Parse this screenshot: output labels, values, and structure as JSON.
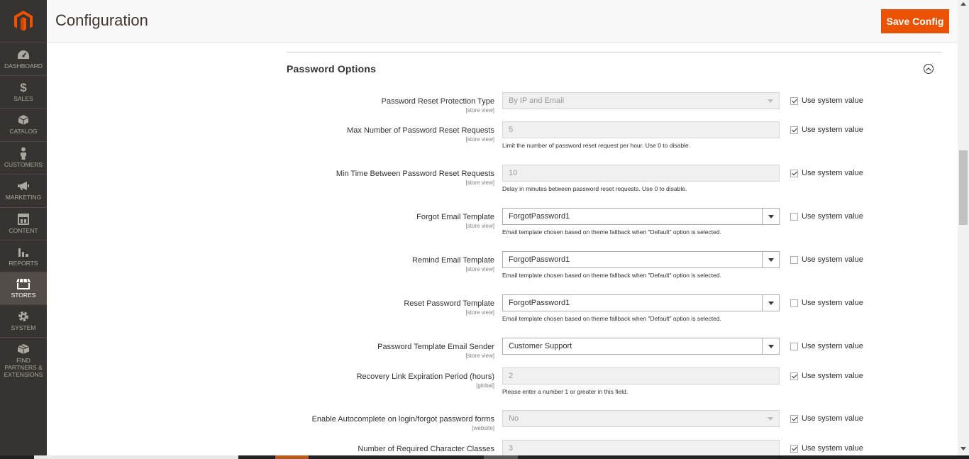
{
  "sidebar": {
    "items": [
      {
        "id": "dashboard",
        "label": "DASHBOARD",
        "icon": "dashboard-icon"
      },
      {
        "id": "sales",
        "label": "SALES",
        "icon": "dollar-icon"
      },
      {
        "id": "catalog",
        "label": "CATALOG",
        "icon": "box-icon"
      },
      {
        "id": "customers",
        "label": "CUSTOMERS",
        "icon": "person-icon"
      },
      {
        "id": "marketing",
        "label": "MARKETING",
        "icon": "megaphone-icon"
      },
      {
        "id": "content",
        "label": "CONTENT",
        "icon": "layout-icon"
      },
      {
        "id": "reports",
        "label": "REPORTS",
        "icon": "bar-chart-icon"
      },
      {
        "id": "stores",
        "label": "STORES",
        "icon": "storefront-icon",
        "active": true
      },
      {
        "id": "system",
        "label": "SYSTEM",
        "icon": "gear-icon"
      },
      {
        "id": "partners",
        "label": "FIND PARTNERS & EXTENSIONS",
        "icon": "cube-icon"
      }
    ]
  },
  "header": {
    "title": "Configuration",
    "save_label": "Save Config"
  },
  "section": {
    "title": "Password Options"
  },
  "fields": [
    {
      "label": "Password Reset Protection Type",
      "scope": "[store view]",
      "type": "select",
      "value": "By IP and Email",
      "disabled": true,
      "note": "",
      "use_system": true
    },
    {
      "label": "Max Number of Password Reset Requests",
      "scope": "[store view]",
      "type": "text",
      "value": "5",
      "disabled": true,
      "note": "Limit the number of password reset request per hour. Use 0 to disable.",
      "use_system": true
    },
    {
      "label": "Min Time Between Password Reset Requests",
      "scope": "[store view]",
      "type": "text",
      "value": "10",
      "disabled": true,
      "note": "Delay in minutes between password reset requests. Use 0 to disable.",
      "use_system": true
    },
    {
      "label": "Forgot Email Template",
      "scope": "[store view]",
      "type": "select",
      "value": "ForgotPassword1",
      "disabled": false,
      "note": "Email template chosen based on theme fallback when \"Default\" option is selected.",
      "use_system": false
    },
    {
      "label": "Remind Email Template",
      "scope": "[store view]",
      "type": "select",
      "value": "ForgotPassword1",
      "disabled": false,
      "note": "Email template chosen based on theme fallback when \"Default\" option is selected.",
      "use_system": false
    },
    {
      "label": "Reset Password Template",
      "scope": "[store view]",
      "type": "select",
      "value": "ForgotPassword1",
      "disabled": false,
      "note": "Email template chosen based on theme fallback when \"Default\" option is selected.",
      "use_system": false
    },
    {
      "label": "Password Template Email Sender",
      "scope": "[store view]",
      "type": "select",
      "value": "Customer Support",
      "disabled": false,
      "note": "",
      "use_system": false
    },
    {
      "label": "Recovery Link Expiration Period (hours)",
      "scope": "[global]",
      "type": "text",
      "value": "2",
      "disabled": true,
      "note": "Please enter a number 1 or greater in this field.",
      "use_system": true
    },
    {
      "label": "Enable Autocomplete on login/forgot password forms",
      "scope": "[website]",
      "type": "select",
      "value": "No",
      "disabled": true,
      "note": "",
      "use_system": true
    },
    {
      "label": "Number of Required Character Classes",
      "scope": "",
      "type": "text",
      "value": "3",
      "disabled": true,
      "note": "",
      "use_system": true
    }
  ],
  "use_system_label": "Use system value"
}
